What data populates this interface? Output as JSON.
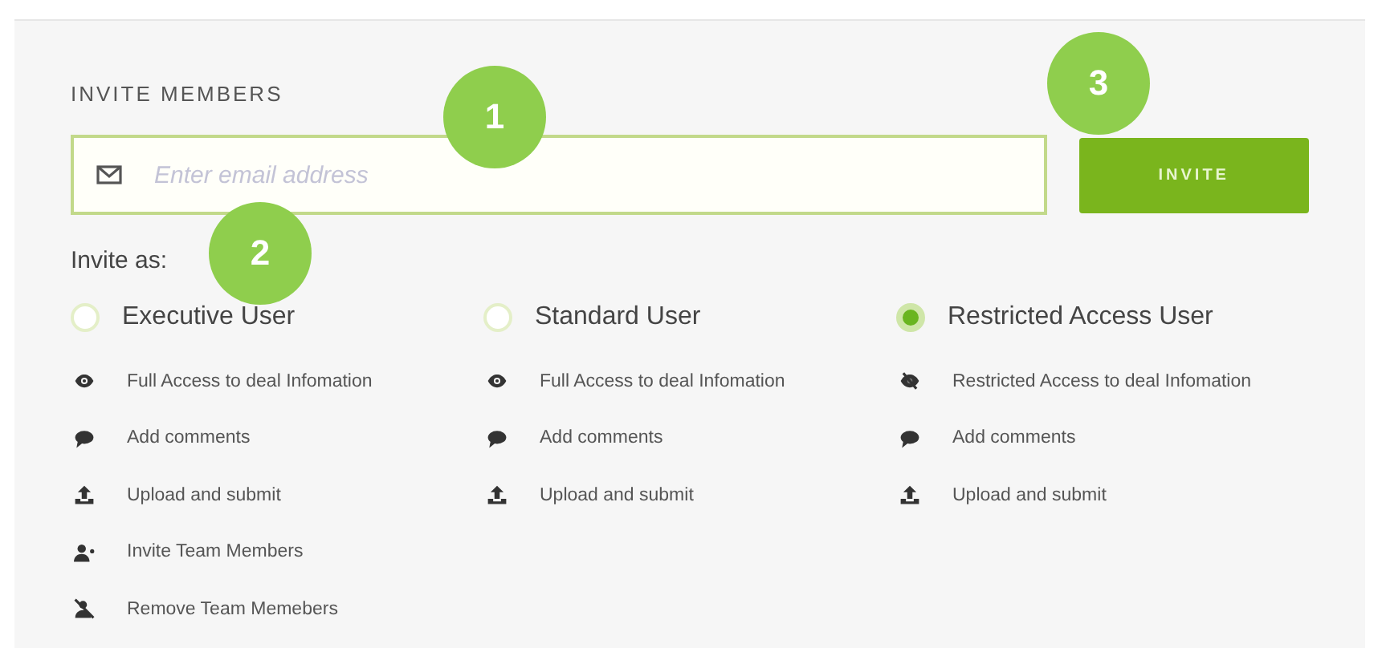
{
  "heading": "INVITE MEMBERS",
  "email_field": {
    "placeholder": "Enter email address"
  },
  "invite_button": "INVITE",
  "invite_as_label": "Invite as:",
  "roles": [
    {
      "label": "Executive User",
      "selected": false,
      "features": [
        {
          "kind": "eye",
          "text": "Full Access to deal Infomation"
        },
        {
          "kind": "comment",
          "text": "Add comments"
        },
        {
          "kind": "upload",
          "text": "Upload and submit"
        },
        {
          "kind": "user-plus",
          "text": "Invite Team Members"
        },
        {
          "kind": "user-remove",
          "text": "Remove Team Memebers"
        }
      ]
    },
    {
      "label": "Standard User",
      "selected": false,
      "features": [
        {
          "kind": "eye",
          "text": "Full Access to deal Infomation"
        },
        {
          "kind": "comment",
          "text": "Add comments"
        },
        {
          "kind": "upload",
          "text": "Upload and submit"
        }
      ]
    },
    {
      "label": "Restricted Access User",
      "selected": true,
      "features": [
        {
          "kind": "eye-slash",
          "text": "Restricted Access to deal Infomation"
        },
        {
          "kind": "comment",
          "text": "Add comments"
        },
        {
          "kind": "upload",
          "text": "Upload and submit"
        }
      ]
    }
  ],
  "callouts": [
    {
      "number": "1"
    },
    {
      "number": "2"
    },
    {
      "number": "3"
    }
  ]
}
